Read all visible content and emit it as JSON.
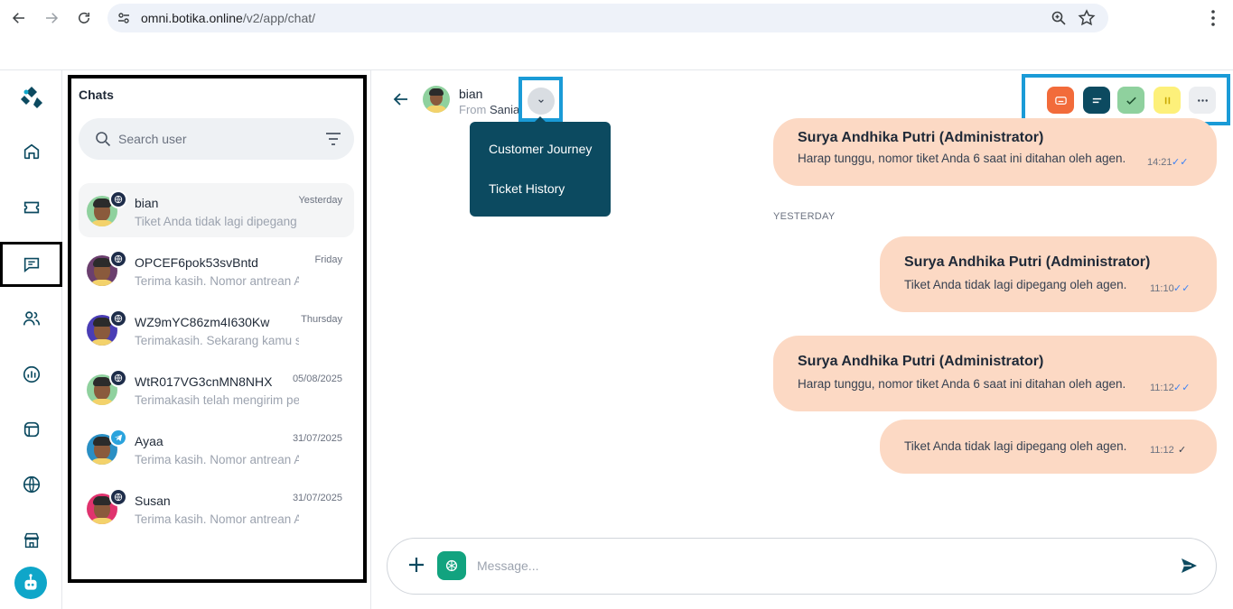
{
  "browser": {
    "url_host": "omni.botika.online",
    "url_path": "/v2/app/chat/"
  },
  "chats": {
    "title": "Chats",
    "search_placeholder": "Search user",
    "items": [
      {
        "name": "bian",
        "date": "Yesterday",
        "preview": "Tiket Anda tidak lagi dipegang oleh agen.",
        "channel": "web",
        "avatar_bg": "#8fd19e"
      },
      {
        "name": "OPCEF6pok53svBntd",
        "date": "Friday",
        "preview": "Terima kasih. Nomor antrean Anda adalah",
        "channel": "web",
        "avatar_bg": "#6b3f6e"
      },
      {
        "name": "WZ9mYC86zm4I630Kw",
        "date": "Thursday",
        "preview": "Terimakasih. Sekarang kamu sudah",
        "channel": "web",
        "avatar_bg": "#4a3db5"
      },
      {
        "name": "WtR017VG3cnMN8NHX",
        "date": "05/08/2025",
        "preview": "Terimakasih telah mengirim pesan",
        "channel": "web",
        "avatar_bg": "#8fd19e"
      },
      {
        "name": "Ayaa",
        "date": "31/07/2025",
        "preview": "Terima kasih. Nomor antrean Anda",
        "channel": "telegram",
        "avatar_bg": "#2a8fc4"
      },
      {
        "name": "Susan",
        "date": "31/07/2025",
        "preview": "Terima kasih. Nomor antrean Anda",
        "channel": "web",
        "avatar_bg": "#e0336e"
      }
    ]
  },
  "conversation": {
    "contact_name": "bian",
    "from_label": "From",
    "from_value": "Sania",
    "menu": [
      "Customer Journey",
      "Ticket History"
    ],
    "day_separator": "YESTERDAY",
    "messages": [
      {
        "sender": "Surya Andhika Putri (Administrator)",
        "text": "Harap tunggu, nomor tiket Anda 6 saat ini ditahan oleh agen.",
        "time": "14:21",
        "tick": "✓✓"
      },
      {
        "sender": "Surya Andhika Putri (Administrator)",
        "text": "Tiket Anda tidak lagi dipegang oleh agen.",
        "time": "11:10",
        "tick": "✓✓"
      },
      {
        "sender": "Surya Andhika Putri (Administrator)",
        "text": "Harap tunggu, nomor tiket Anda 6 saat ini ditahan oleh agen.",
        "time": "11:12",
        "tick": "✓✓"
      },
      {
        "sender": "",
        "text": "Tiket Anda tidak lagi dipegang oleh agen.",
        "time": "11:12",
        "tick": "✓"
      }
    ],
    "composer_placeholder": "Message..."
  },
  "colors": {
    "bubble": "#fcd9c4",
    "menu_bg": "#0c4a60",
    "highlight": "#1a9bd7",
    "action_orange": "#f26b3a",
    "action_navy": "#0c4a60",
    "action_green": "#8fd19e",
    "action_yellow": "#fdf07a",
    "action_gray": "#eceef1"
  }
}
